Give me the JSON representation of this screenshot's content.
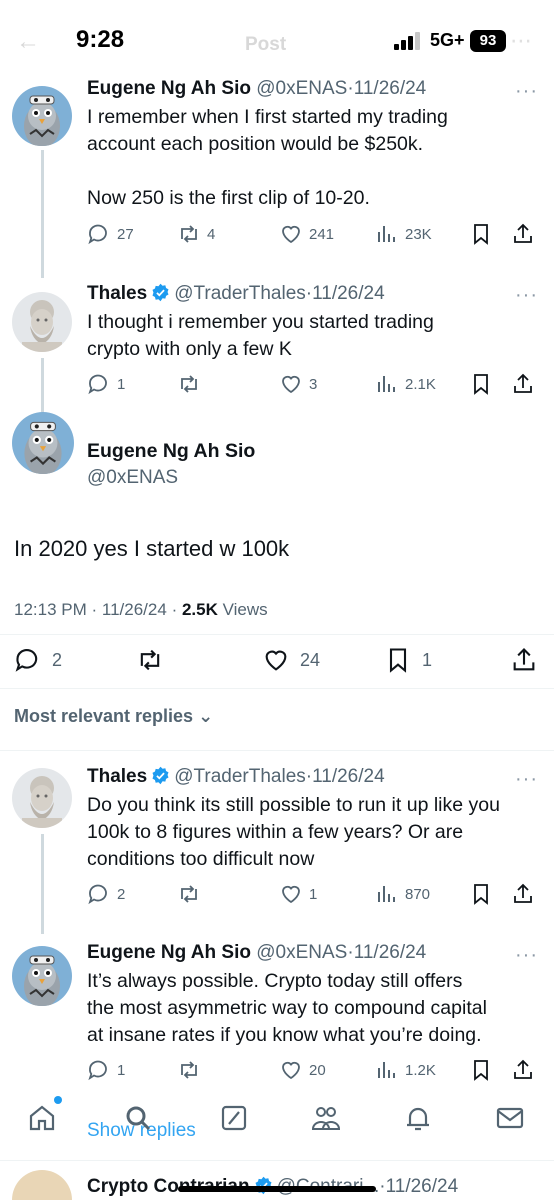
{
  "status_bar": {
    "time": "9:28",
    "network": "5G+",
    "battery": "93",
    "ghost_title": "Post",
    "ghost_back": "←",
    "ghost_more": "⋯"
  },
  "posts": [
    {
      "name": "Eugene Ng Ah Sio",
      "handle": "@0xENAS",
      "dot": "·",
      "date": "11/26/24",
      "more": "···",
      "text_lines": [
        "I remember when I first started my trading",
        "account each position would be $250k.",
        "",
        "Now 250 is the first clip of 10-20."
      ],
      "replies": "27",
      "reposts": "4",
      "likes": "241",
      "views": "23K"
    },
    {
      "name": "Thales",
      "handle": "@TraderThales",
      "dot": "·",
      "date": "11/26/24",
      "more": "···",
      "text_lines": [
        "I thought i remember you started trading",
        "crypto with only a few K"
      ],
      "replies": "1",
      "reposts": "",
      "likes": "3",
      "views": "2.1K"
    }
  ],
  "main_post": {
    "name": "Eugene Ng Ah Sio",
    "handle": "@0xENAS",
    "text": "In 2020 yes I started w 100k",
    "time": "12:13 PM",
    "dot1": "·",
    "date": "11/26/24",
    "dot2": "·",
    "views_count": "2.5K",
    "views_label": "Views",
    "replies": "2",
    "likes": "24",
    "bookmarks": "1"
  },
  "replies_header": {
    "label": "Most relevant replies",
    "chevron": "⌄"
  },
  "replies": [
    {
      "name": "Thales",
      "handle": "@TraderThales",
      "dot": "·",
      "date": "11/26/24",
      "more": "···",
      "text_lines": [
        "Do you think its still possible to run it up like you",
        "100k to 8 figures within a few years? Or are",
        "conditions too difficult now"
      ],
      "replies": "2",
      "likes": "1",
      "views": "870"
    },
    {
      "name": "Eugene Ng Ah Sio",
      "handle": "@0xENAS",
      "dot": "·",
      "date": "11/26/24",
      "more": "···",
      "text_lines": [
        "It’s always possible. Crypto today still offers",
        "the most asymmetric way to compound capital",
        "at insane rates if you know what you’re doing."
      ],
      "replies": "1",
      "likes": "20",
      "views": "1.2K"
    }
  ],
  "show_replies": "Show replies",
  "last_reply": {
    "name": "Crypto Contrarian",
    "handle": "@Contrari...",
    "dot": "·",
    "date": "11/26/24"
  },
  "colors": {
    "accent": "#1d9bf0",
    "text": "#0f1419",
    "muted": "#536471",
    "verified": "#1d9bf0"
  },
  "icons": [
    "reply-icon",
    "repost-icon",
    "like-icon",
    "views-icon",
    "bookmark-icon",
    "share-icon",
    "verified-icon",
    "home-icon",
    "search-icon",
    "grok-icon",
    "communities-icon",
    "notifications-icon",
    "messages-icon"
  ]
}
